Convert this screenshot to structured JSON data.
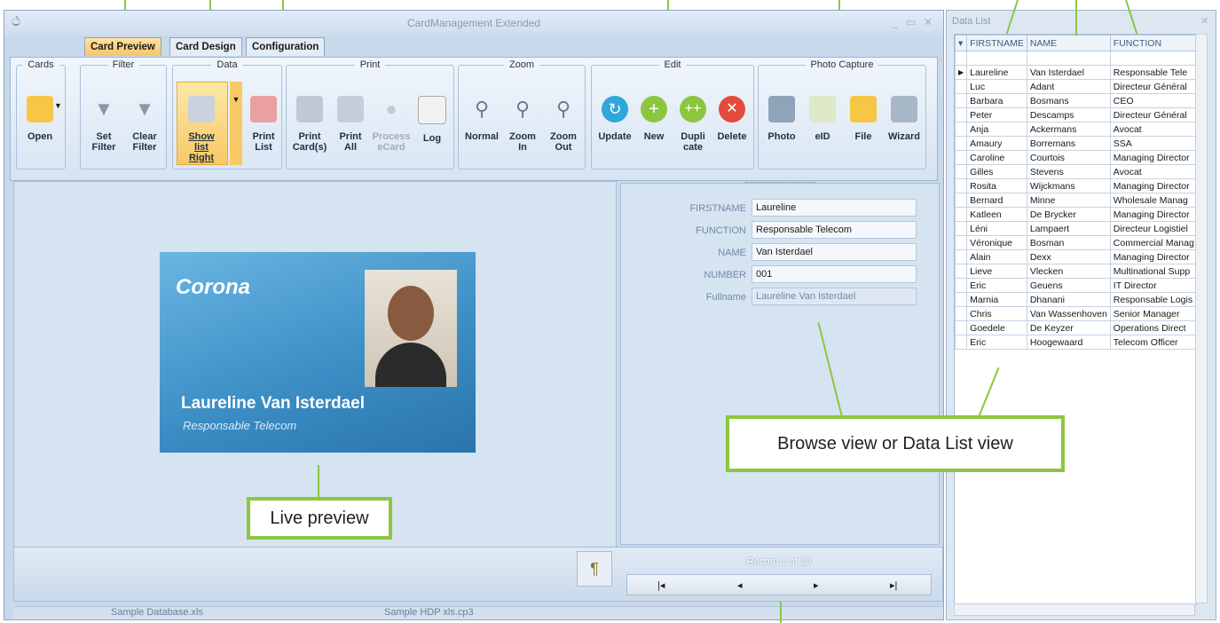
{
  "window": {
    "title": "CardManagement Extended"
  },
  "tabs": [
    "Card Preview",
    "Card Design",
    "Configuration"
  ],
  "ribbon": {
    "groups": {
      "cards": "Cards",
      "filter": "Filter",
      "data": "Data",
      "print": "Print",
      "zoom": "Zoom",
      "edit": "Edit",
      "photo": "Photo Capture"
    },
    "buttons": {
      "open": "Open",
      "set_filter": [
        "Set",
        "Filter"
      ],
      "clear_filter": [
        "Clear",
        "Filter"
      ],
      "show_list": [
        "Show list",
        "Right"
      ],
      "print_list": [
        "Print",
        "List"
      ],
      "print_cards": [
        "Print",
        "Card(s)"
      ],
      "print_all": [
        "Print",
        "All"
      ],
      "process_ecard": [
        "Process",
        "eCard"
      ],
      "log": "Log",
      "normal": "Normal",
      "zoom_in": [
        "Zoom",
        "In"
      ],
      "zoom_out": [
        "Zoom",
        "Out"
      ],
      "update": "Update",
      "new": "New",
      "duplicate": [
        "Dupli",
        "cate"
      ],
      "delete": "Delete",
      "photo": "Photo",
      "eid": "eID",
      "file": "File",
      "wizard": "Wizard"
    }
  },
  "card": {
    "logo": "Corona",
    "name": "Laureline Van Isterdael",
    "function": "Responsable Telecom"
  },
  "form": {
    "fields": [
      {
        "label": "FIRSTNAME",
        "value": "Laureline"
      },
      {
        "label": "FUNCTION",
        "value": "Responsable Telecom"
      },
      {
        "label": "NAME",
        "value": "Van Isterdael"
      },
      {
        "label": "NUMBER",
        "value": "001"
      },
      {
        "label": "Fullname",
        "value": "Laureline Van Isterdael"
      }
    ]
  },
  "nav": {
    "record": "Record 1 of 20"
  },
  "status": {
    "database": "Sample Database.xls",
    "project": "Sample HDP xls.cp3"
  },
  "datalist": {
    "title": "Data List",
    "columns": [
      "FIRSTNAME",
      "NAME",
      "FUNCTION"
    ],
    "rows": [
      [
        "Laureline",
        "Van Isterdael",
        "Responsable Tele"
      ],
      [
        "Luc",
        "Adant",
        "Directeur Général"
      ],
      [
        "Barbara",
        "Bosmans",
        "CEO"
      ],
      [
        "Peter",
        "Descamps",
        "Directeur Général"
      ],
      [
        "Anja",
        "Ackermans",
        "Avocat"
      ],
      [
        "Amaury",
        "Borremans",
        "SSA"
      ],
      [
        "Caroline",
        "Courtois",
        "Managing Director"
      ],
      [
        "Gilles",
        "Stevens",
        "Avocat"
      ],
      [
        "Rosita",
        "Wijckmans",
        "Managing Director"
      ],
      [
        "Bernard",
        "Minne",
        "Wholesale Manag"
      ],
      [
        "Katleen",
        "De Brycker",
        "Managing Director"
      ],
      [
        "Léni",
        "Lampaert",
        "Directeur Logistiel"
      ],
      [
        "Véronique",
        "Bosman",
        "Commercial Manag"
      ],
      [
        "Alain",
        "Dexx",
        "Managing Director"
      ],
      [
        "Lieve",
        "Vlecken",
        "Multinational Supp"
      ],
      [
        "Eric",
        "Geuens",
        "IT Director"
      ],
      [
        "Marnia",
        "Dhanani",
        "Responsable Logis"
      ],
      [
        "Chris",
        "Van Wassenhoven",
        "Senior Manager"
      ],
      [
        "Goedele",
        "De Keyzer",
        "Operations Direct"
      ],
      [
        "Eric",
        "Hoogewaard",
        "Telecom Officer"
      ]
    ]
  },
  "callouts": {
    "browse": "Browse view or Data List view",
    "live": "Live preview"
  },
  "colors": {
    "callout_border": "#8dc63f",
    "tab_active": "#f7c56a",
    "card_blue": "#3d8fc6"
  }
}
